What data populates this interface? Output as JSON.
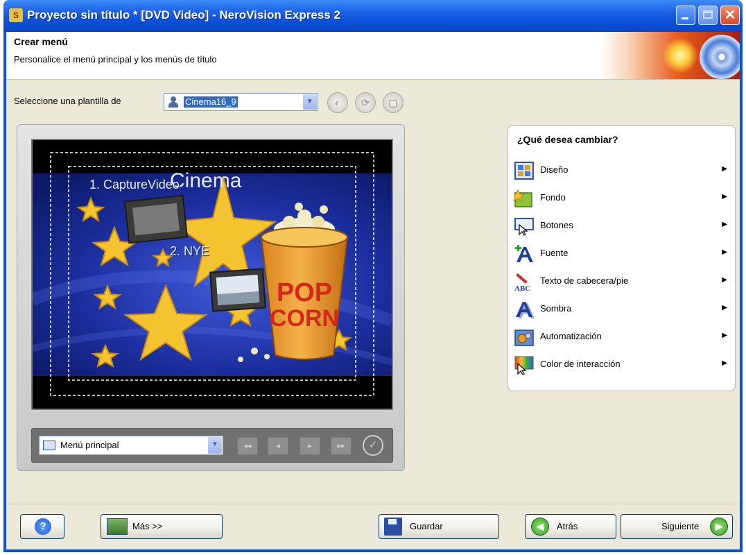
{
  "window": {
    "title": "Proyecto sin título * [DVD Video] - NeroVision Express 2",
    "app_icon_glyph": "S",
    "close_glyph": "✕"
  },
  "header": {
    "title": "Crear menú",
    "subtitle": "Personalice el menú principal y los menús de título"
  },
  "template": {
    "label": "Seleccione una plantilla de",
    "value": "Cinema16_9",
    "round_buttons": [
      "◐",
      "⟳",
      "▢"
    ]
  },
  "preview": {
    "title_word": "Cinema",
    "items": [
      "1. CaptureVideo",
      "2. NYE"
    ],
    "popcorn_text_top": "POP",
    "popcorn_text_bottom": "CORN",
    "menu_select": "Menú principal",
    "bar_buttons": [
      "◂◂",
      "◂",
      "▸",
      "▸▸"
    ],
    "ok_glyph": "✓"
  },
  "panel": {
    "title": "¿Qué desea cambiar?",
    "arrow": "▶",
    "options": [
      {
        "label": "Diseño",
        "icon": "layout-icon"
      },
      {
        "label": "Fondo",
        "icon": "background-icon"
      },
      {
        "label": "Botones",
        "icon": "buttons-icon"
      },
      {
        "label": "Fuente",
        "icon": "font-icon"
      },
      {
        "label": "Texto de cabecera/pie",
        "icon": "header-footer-text-icon"
      },
      {
        "label": "Sombra",
        "icon": "shadow-icon"
      },
      {
        "label": "Automatización",
        "icon": "automation-icon"
      },
      {
        "label": "Color de interacción",
        "icon": "interaction-color-icon"
      }
    ]
  },
  "footer": {
    "help_glyph": "?",
    "more": "Más >>",
    "save": "Guardar",
    "back": "Atrás",
    "next": "Siguiente",
    "back_glyph": "◀",
    "next_glyph": "▶"
  }
}
